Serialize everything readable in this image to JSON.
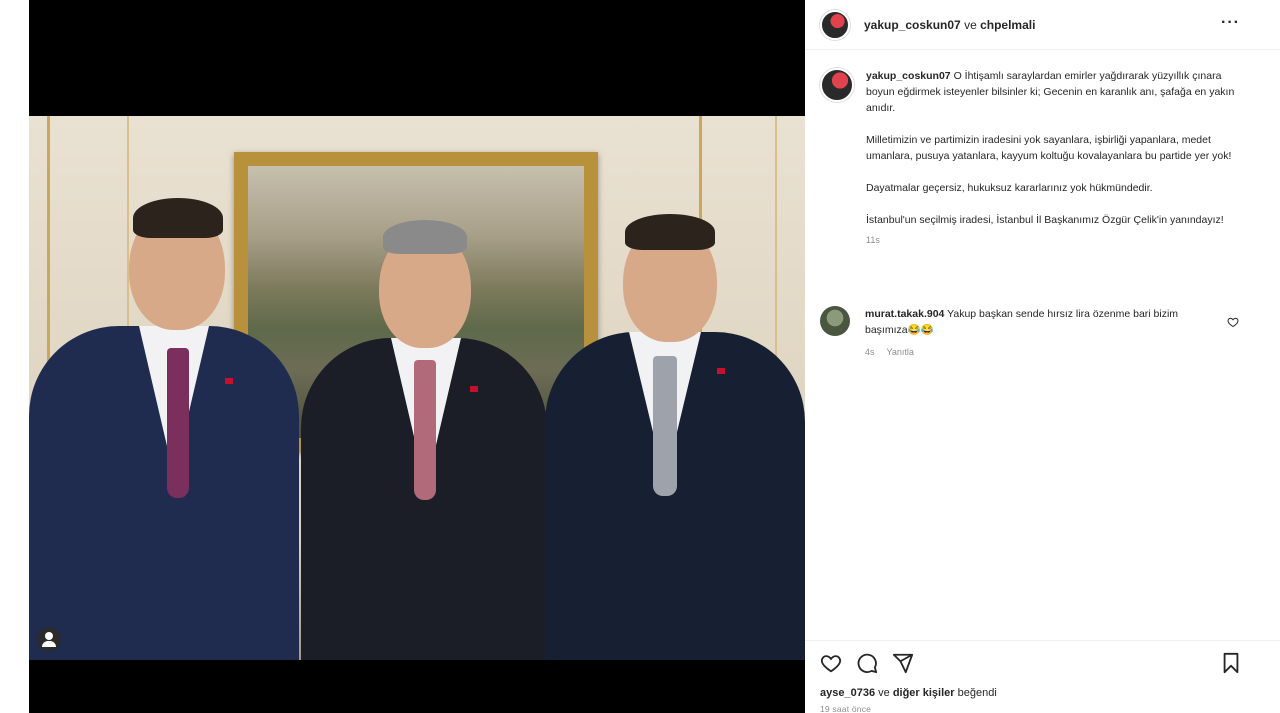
{
  "post": {
    "header": {
      "username": "yakup_coskun07",
      "conjunction": "ve",
      "collaborator": "chpelmali"
    },
    "caption": {
      "username": "yakup_coskun07",
      "paragraph1": "O İhtişamlı saraylardan emirler yağdırarak yüzyıllık çınara boyun eğdirmek isteyenler bilsinler ki; Gecenin en karanlık anı, şafağa en yakın anıdır.",
      "paragraph2": "Milletimizin ve partimizin iradesini yok sayanlara, işbirliği yapanlara, medet umanlara, pusuya yatanlara, kayyum koltuğu kovalayanlara bu partide yer yok!",
      "paragraph3": "Dayatmalar geçersiz, hukuksuz kararlarınız yok hükmündedir.",
      "paragraph4": "İstanbul'un seçilmiş iradesi, İstanbul İl Başkanımız Özgür Çelik'in yanındayız!",
      "time": "11s"
    },
    "comment": {
      "username": "murat.takak.904",
      "text": "Yakup başkan sende hırsız lira özenme bari bizim başımıza😂😂",
      "time": "4s",
      "reply_label": "Yanıtla"
    },
    "likes": {
      "user": "ayse_0736",
      "conjunction": "ve",
      "others": "diğer kişiler",
      "suffix": "beğendi"
    },
    "posted_ago": "19 saat önce"
  },
  "icons": {
    "more": "more-options-icon",
    "like": "heart-icon",
    "comment": "comment-icon",
    "share": "share-icon",
    "save": "bookmark-icon",
    "tag": "user-tag-icon"
  },
  "colors": {
    "text": "#262626",
    "muted": "#8e8e8e",
    "divider": "#efefef",
    "media_bg": "#000000",
    "tie_purple": "#7a2f5c",
    "tie_pink": "#b06a7a",
    "tie_silver": "#9ea3ab",
    "suit_navy": "#1e2a4a"
  }
}
